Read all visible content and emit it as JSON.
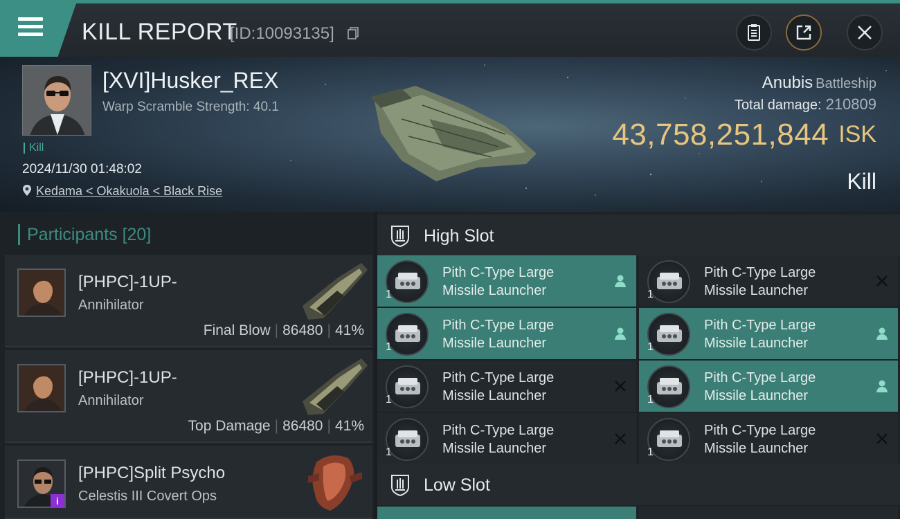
{
  "header": {
    "title": "KILL REPORT",
    "report_id": "[ID:10093135]"
  },
  "victim": {
    "name": "[XVI]Husker_REX",
    "warp_scramble": "Warp Scramble Strength: 40.1",
    "tag": "Kill",
    "datetime": "2024/11/30 01:48:02",
    "location": "Kedama < Okakuola < Black Rise",
    "ship_name": "Anubis",
    "ship_class": "Battleship",
    "total_damage_label": "Total damage:",
    "total_damage": "210809",
    "isk_value": "43,758,251,844",
    "isk_unit": "ISK",
    "result": "Kill"
  },
  "colors": {
    "accent": "#3b8f84",
    "isk": "#e8c57e",
    "fitted_slot": "#3a7e76",
    "empty_slot": "#23282d"
  },
  "participants": {
    "label": "Participants",
    "count": "[20]",
    "items": [
      {
        "name": "[PHPC]-1UP-",
        "ship": "Annihilator",
        "role": "Final Blow",
        "damage": "86480",
        "percent": "41%"
      },
      {
        "name": "[PHPC]-1UP-",
        "ship": "Annihilator",
        "role": "Top Damage",
        "damage": "86480",
        "percent": "41%"
      },
      {
        "name": "[PHPC]Split Psycho",
        "ship": "Celestis III Covert Ops",
        "badge": "i"
      }
    ]
  },
  "high_slot": {
    "title": "High Slot",
    "modules": [
      {
        "qty": "1",
        "line1": "Pith C-Type Large",
        "line2": "Missile Launcher",
        "status": "person-icon"
      },
      {
        "qty": "1",
        "line1": "Pith C-Type Large",
        "line2": "Missile Launcher",
        "status": "x-icon"
      },
      {
        "qty": "1",
        "line1": "Pith C-Type Large",
        "line2": "Missile Launcher",
        "status": "person-icon"
      },
      {
        "qty": "1",
        "line1": "Pith C-Type Large",
        "line2": "Missile Launcher",
        "status": "person-icon"
      },
      {
        "qty": "1",
        "line1": "Pith C-Type Large",
        "line2": "Missile Launcher",
        "status": "x-icon"
      },
      {
        "qty": "1",
        "line1": "Pith C-Type Large",
        "line2": "Missile Launcher",
        "status": "person-icon"
      },
      {
        "qty": "1",
        "line1": "Pith C-Type Large",
        "line2": "Missile Launcher",
        "status": "x-icon"
      },
      {
        "qty": "1",
        "line1": "Pith C-Type Large",
        "line2": "Missile Launcher",
        "status": "x-icon"
      }
    ]
  },
  "low_slot": {
    "title": "Low Slot"
  }
}
